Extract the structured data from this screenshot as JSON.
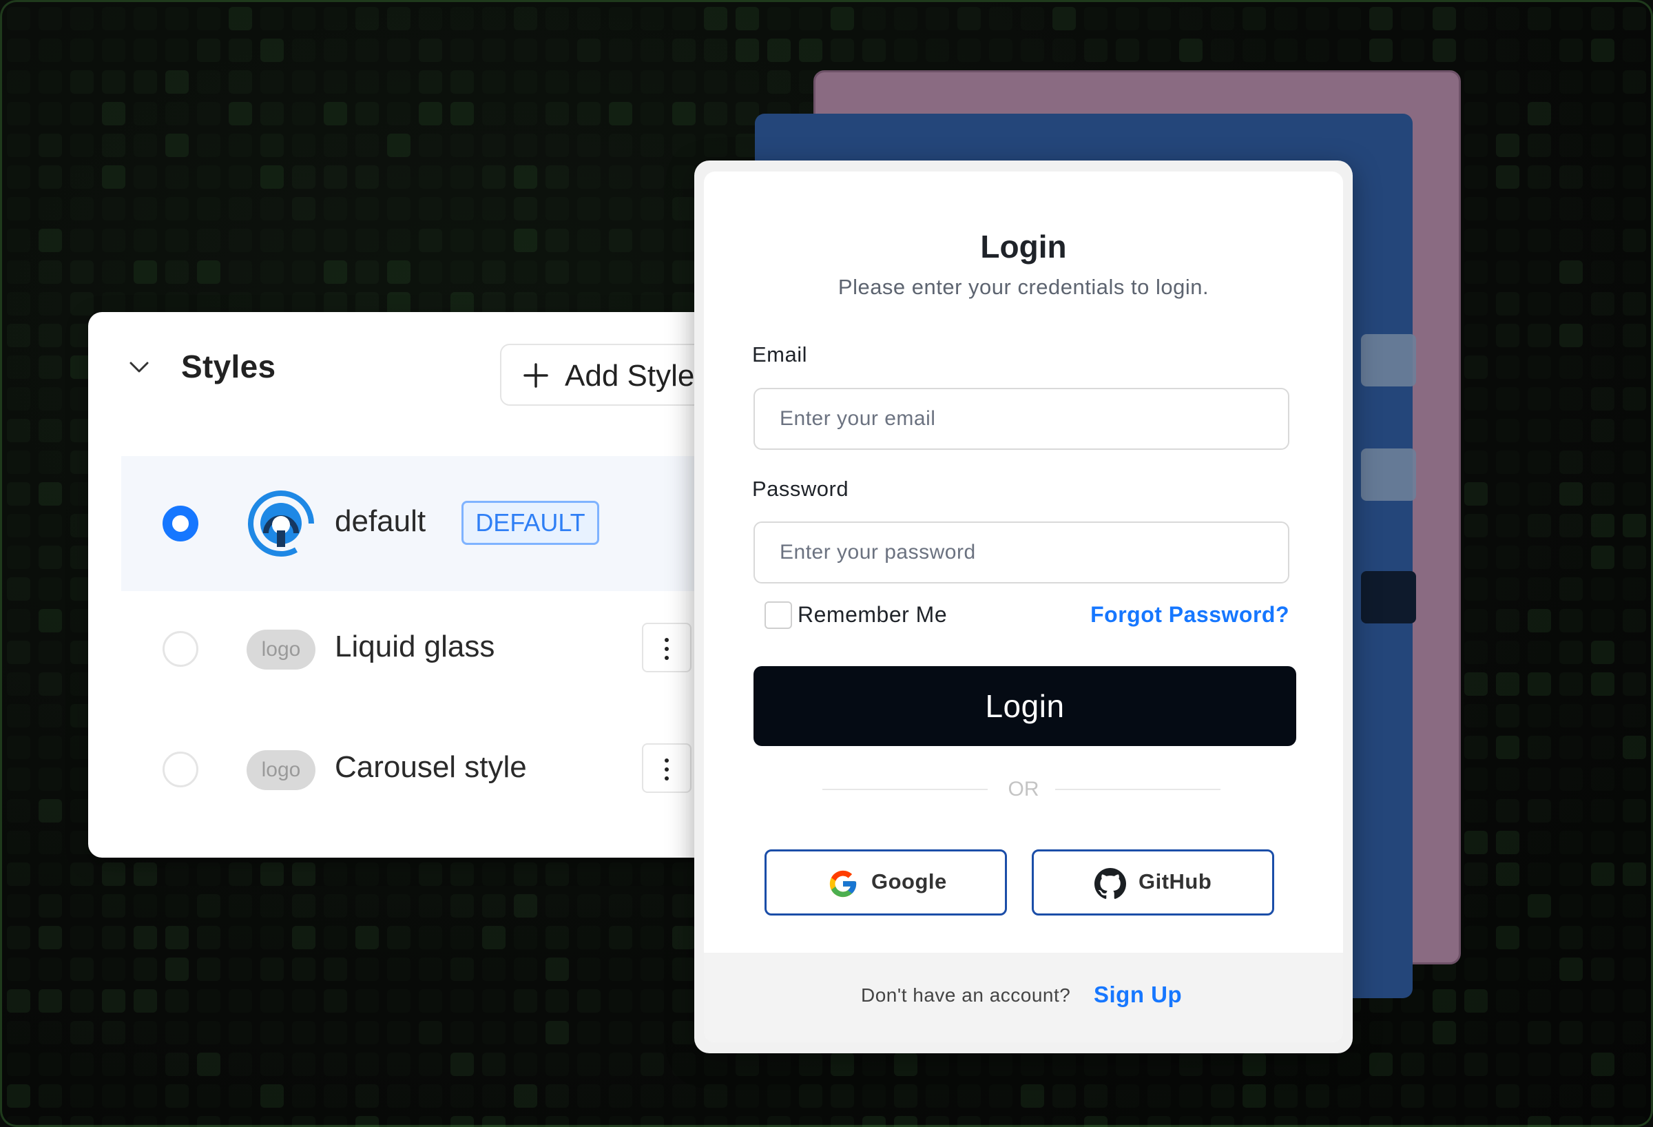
{
  "styles_panel": {
    "title": "Styles",
    "add_button_label": "Add Styles",
    "items": [
      {
        "name": "default",
        "badge": "DEFAULT",
        "selected": true,
        "logo_text": ""
      },
      {
        "name": "Liquid glass",
        "selected": false,
        "logo_text": "logo"
      },
      {
        "name": "Carousel style",
        "selected": false,
        "logo_text": "logo"
      }
    ]
  },
  "login": {
    "title": "Login",
    "subtitle": "Please enter your credentials to login.",
    "email_label": "Email",
    "email_placeholder": "Enter your email",
    "password_label": "Password",
    "password_placeholder": "Enter your password",
    "remember_label": "Remember Me",
    "forgot_label": "Forgot Password?",
    "login_button": "Login",
    "divider_text": "OR",
    "google_label": "Google",
    "github_label": "GitHub",
    "signup_prompt": "Don't have an account?",
    "signup_link": "Sign Up"
  },
  "colors": {
    "accent": "#1677ff",
    "login_button_bg": "#050b14",
    "back_card_purple": "#8a6b82",
    "back_card_blue": "#24467a",
    "background": "#0a0d0a"
  },
  "icons": [
    "chevron-down-icon",
    "plus-icon",
    "brand-logo-icon",
    "more-vertical-icon",
    "google-icon",
    "github-icon"
  ]
}
